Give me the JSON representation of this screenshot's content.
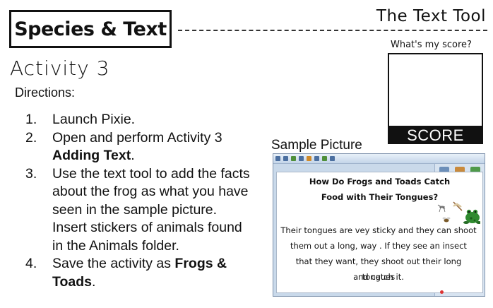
{
  "header": {
    "title": "Species & Text",
    "tool_title": "The Text Tool"
  },
  "activity": "Activity 3",
  "directions_label": "Directions:",
  "steps": [
    {
      "num": "1.",
      "text": "Launch Pixie.",
      "bold": "",
      "after": ""
    },
    {
      "num": "2.",
      "text": "Open and perform Activity 3 ",
      "bold": "Adding Text",
      "after": "."
    },
    {
      "num": "3.",
      "text": "Use the text tool to add the facts about the frog as what you have seen in the sample picture. Insert stickers of animals found in the Animals folder.",
      "bold": "",
      "after": ""
    },
    {
      "num": "4.",
      "text": "Save the activity as ",
      "bold": "Frogs & Toads",
      "after": "."
    }
  ],
  "score": {
    "question": "What's my score?",
    "label": "SCORE"
  },
  "sample": {
    "label": "Sample Picture",
    "heading_line1": "How Do Frogs and Toads Catch",
    "heading_line2": "Food with Their Tongues?",
    "body_lines": [
      "Their tongues are vey sticky and they can shoot",
      "them out a long, way . If they see an insect",
      "that they want, they shoot out their long tongues",
      "and catch it."
    ]
  },
  "colors": {
    "score_bar": "#111111",
    "pixie_chrome": "#c9d9ea"
  }
}
